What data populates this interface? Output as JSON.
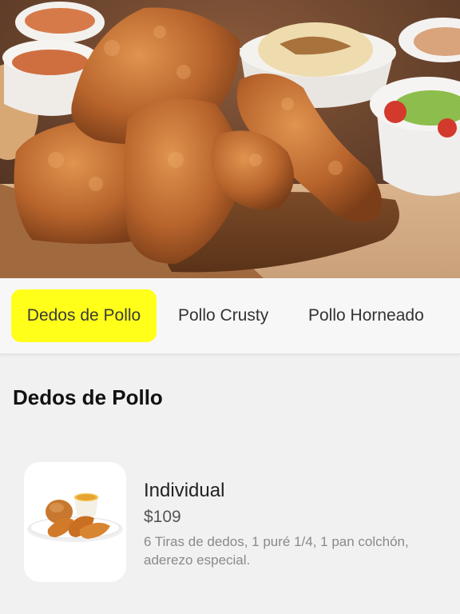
{
  "hero": {
    "image_icon": "fried-chicken-platter-image"
  },
  "tabs": [
    {
      "label": "Dedos de Pollo",
      "active": true
    },
    {
      "label": "Pollo Crusty",
      "active": false
    },
    {
      "label": "Pollo Horneado",
      "active": false
    }
  ],
  "colors": {
    "active_tab": "#ffff1a",
    "page_background": "#f1f1f1"
  },
  "section": {
    "title": "Dedos de Pollo"
  },
  "items": [
    {
      "name": "Individual",
      "price": "$109",
      "description": "6 Tiras de dedos, 1 puré 1/4, 1 pan colchón, aderezo especial.",
      "image_icon": "chicken-tenders-meal-image"
    }
  ]
}
